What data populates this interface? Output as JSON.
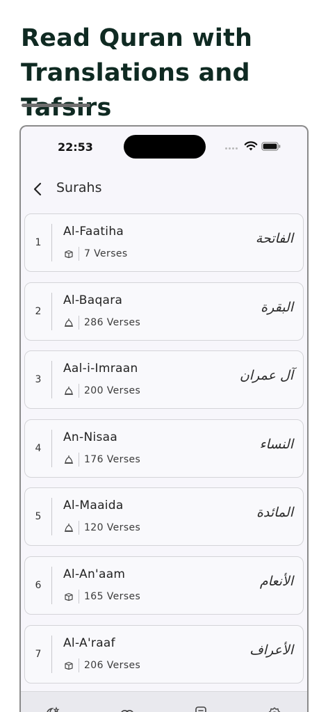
{
  "headline": {
    "line1": "Read Quran with",
    "line2": "Translations and Tafsirs"
  },
  "status": {
    "time": "22:53"
  },
  "nav": {
    "title": "Surahs"
  },
  "surahs": [
    {
      "number": "1",
      "name": "Al-Faatiha",
      "verses": "7 Verses",
      "place_icon": "kaaba-icon",
      "arabic": "الفاتحة"
    },
    {
      "number": "2",
      "name": "Al-Baqara",
      "verses": "286 Verses",
      "place_icon": "mosque-dome-icon",
      "arabic": "البقرة"
    },
    {
      "number": "3",
      "name": "Aal-i-Imraan",
      "verses": "200 Verses",
      "place_icon": "mosque-dome-icon",
      "arabic": "آل عمران"
    },
    {
      "number": "4",
      "name": "An-Nisaa",
      "verses": "176 Verses",
      "place_icon": "mosque-dome-icon",
      "arabic": "النساء"
    },
    {
      "number": "5",
      "name": "Al-Maaida",
      "verses": "120 Verses",
      "place_icon": "mosque-dome-icon",
      "arabic": "المائدة"
    },
    {
      "number": "6",
      "name": "Al-An'aam",
      "verses": "165 Verses",
      "place_icon": "kaaba-icon",
      "arabic": "الأنعام"
    },
    {
      "number": "7",
      "name": "Al-A'raaf",
      "verses": "206 Verses",
      "place_icon": "kaaba-icon",
      "arabic": "الأعراف"
    }
  ],
  "tab_bar": {
    "icons": [
      "star-crescent-icon",
      "rings-icon",
      "book-icon",
      "settings-icon"
    ]
  },
  "colors": {
    "headline": "#0f2a22",
    "screen_bg": "#f7f6fb",
    "card_border": "#d4d4d8"
  }
}
